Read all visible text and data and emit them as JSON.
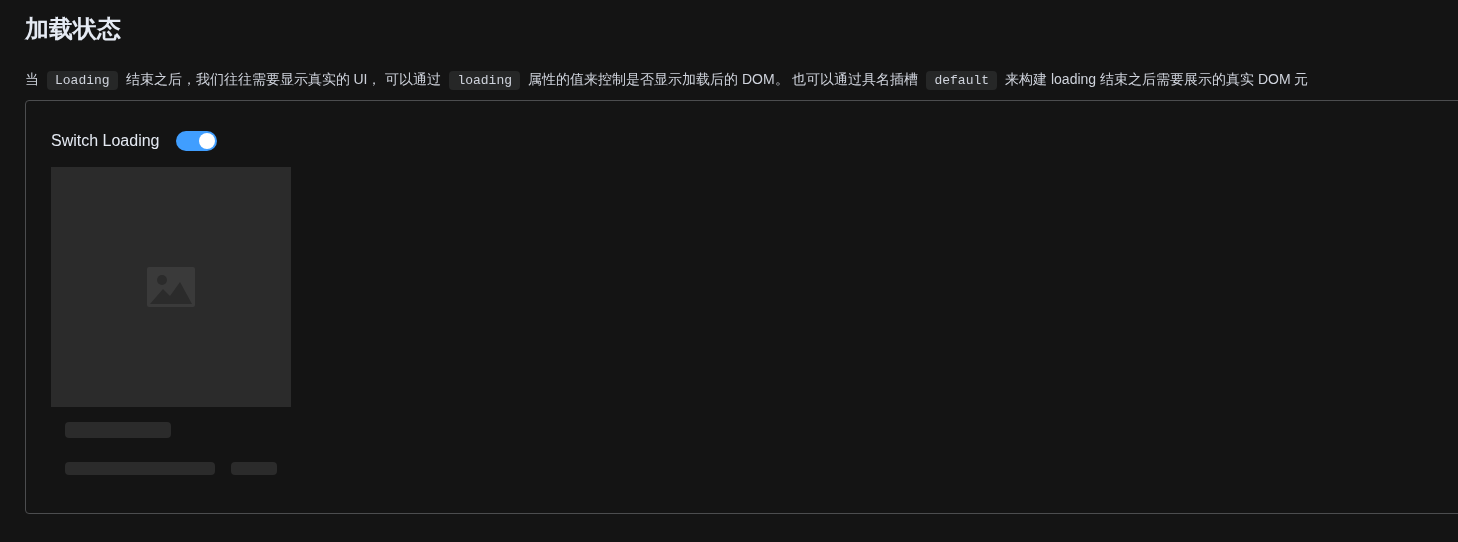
{
  "heading": "加载状态",
  "description": [
    {
      "kind": "text",
      "text": "当"
    },
    {
      "kind": "code",
      "text": "Loading"
    },
    {
      "kind": "text",
      "text": "结束之后，我们往往需要显示真实的 UI， 可以通过"
    },
    {
      "kind": "code",
      "text": "loading"
    },
    {
      "kind": "text",
      "text": "属性的值来控制是否显示加载后的 DOM。 也可以通过具名插槽"
    },
    {
      "kind": "code",
      "text": "default"
    },
    {
      "kind": "text",
      "text": "来构建 loading 结束之后需要展示的真实 DOM 元"
    }
  ],
  "demo": {
    "switch": {
      "label": "Switch Loading",
      "on": true
    }
  }
}
